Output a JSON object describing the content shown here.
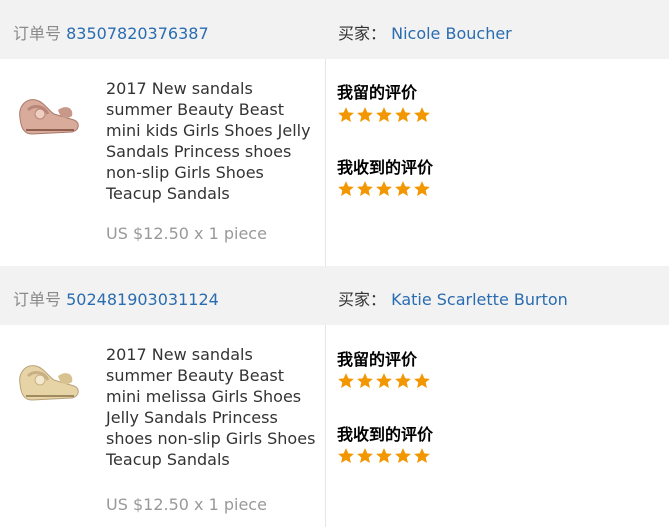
{
  "orders": [
    {
      "order_no_label": "订单号",
      "order_no": "83507820376387",
      "buyer_label": "买家：",
      "buyer_name": "Nicole Boucher",
      "product_title": "2017 New sandals summer Beauty Beast mini kids Girls Shoes Jelly Sandals Princess shoes non-slip Girls Shoes Teacup Sandals",
      "price_line": "US $12.50 x 1 piece",
      "my_review_label": "我留的评价",
      "my_review_stars": 5,
      "received_review_label": "我收到的评价",
      "received_review_stars": 5,
      "thumb_color": "#d9ab9a"
    },
    {
      "order_no_label": "订单号",
      "order_no": "502481903031124",
      "buyer_label": "买家：",
      "buyer_name": "Katie Scarlette Burton",
      "product_title": "2017 New sandals summer Beauty Beast mini melissa Girls Shoes Jelly Sandals Princess shoes non-slip Girls Shoes Teacup Sandals",
      "price_line": "US $12.50 x 1 piece",
      "my_review_label": "我留的评价",
      "my_review_stars": 5,
      "received_review_label": "我收到的评价",
      "received_review_stars": 5,
      "thumb_color": "#e6d3a6"
    }
  ],
  "colors": {
    "link": "#2a6cb0",
    "star": "#f39700",
    "header_bg": "#f2f2f2"
  },
  "icons": {
    "star": "star-icon",
    "product": "sandal-thumbnail"
  }
}
